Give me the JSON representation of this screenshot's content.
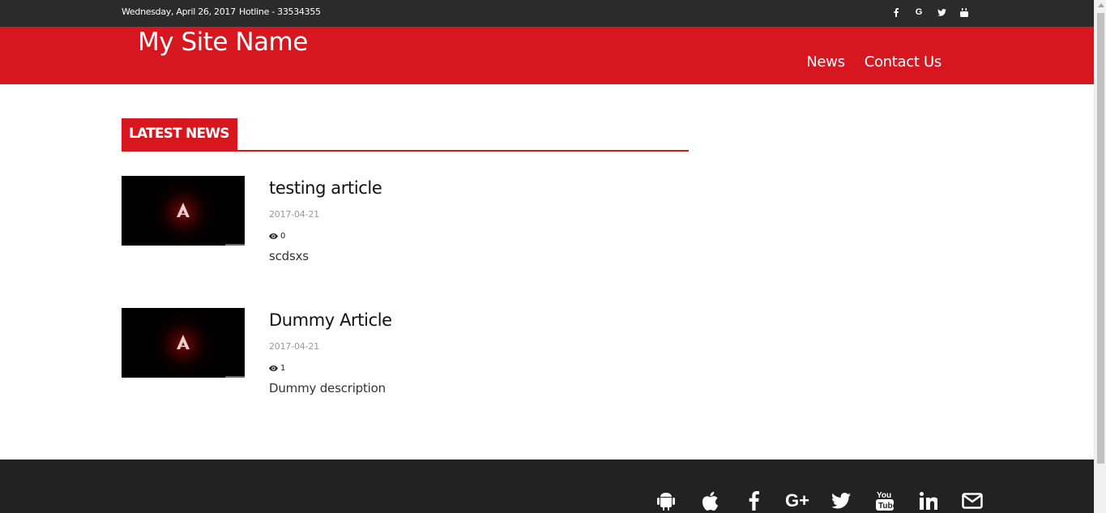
{
  "topbar": {
    "date": "Wednesday, April 26, 2017",
    "hotline": "Hotline - 33534355",
    "icons": [
      "facebook-icon",
      "google-icon",
      "twitter-icon",
      "youtube-icon"
    ]
  },
  "header": {
    "site_name": "My Site Name",
    "nav": [
      {
        "label": "News"
      },
      {
        "label": "Contact Us"
      }
    ]
  },
  "section": {
    "title": "LATEST NEWS"
  },
  "articles": [
    {
      "title": "testing article",
      "date": "2017-04-21",
      "views": "0",
      "description": "scdsxs"
    },
    {
      "title": "Dummy Article",
      "date": "2017-04-21",
      "views": "1",
      "description": "Dummy description"
    }
  ],
  "footer": {
    "icons": [
      "android-icon",
      "apple-icon",
      "facebook-icon",
      "google-plus-icon",
      "twitter-icon",
      "youtube-icon",
      "linkedin-icon",
      "envelope-icon"
    ]
  },
  "colors": {
    "brand_red": "#d7171f",
    "topbar_bg": "#2b2b2b",
    "footer_bg": "#222222"
  }
}
